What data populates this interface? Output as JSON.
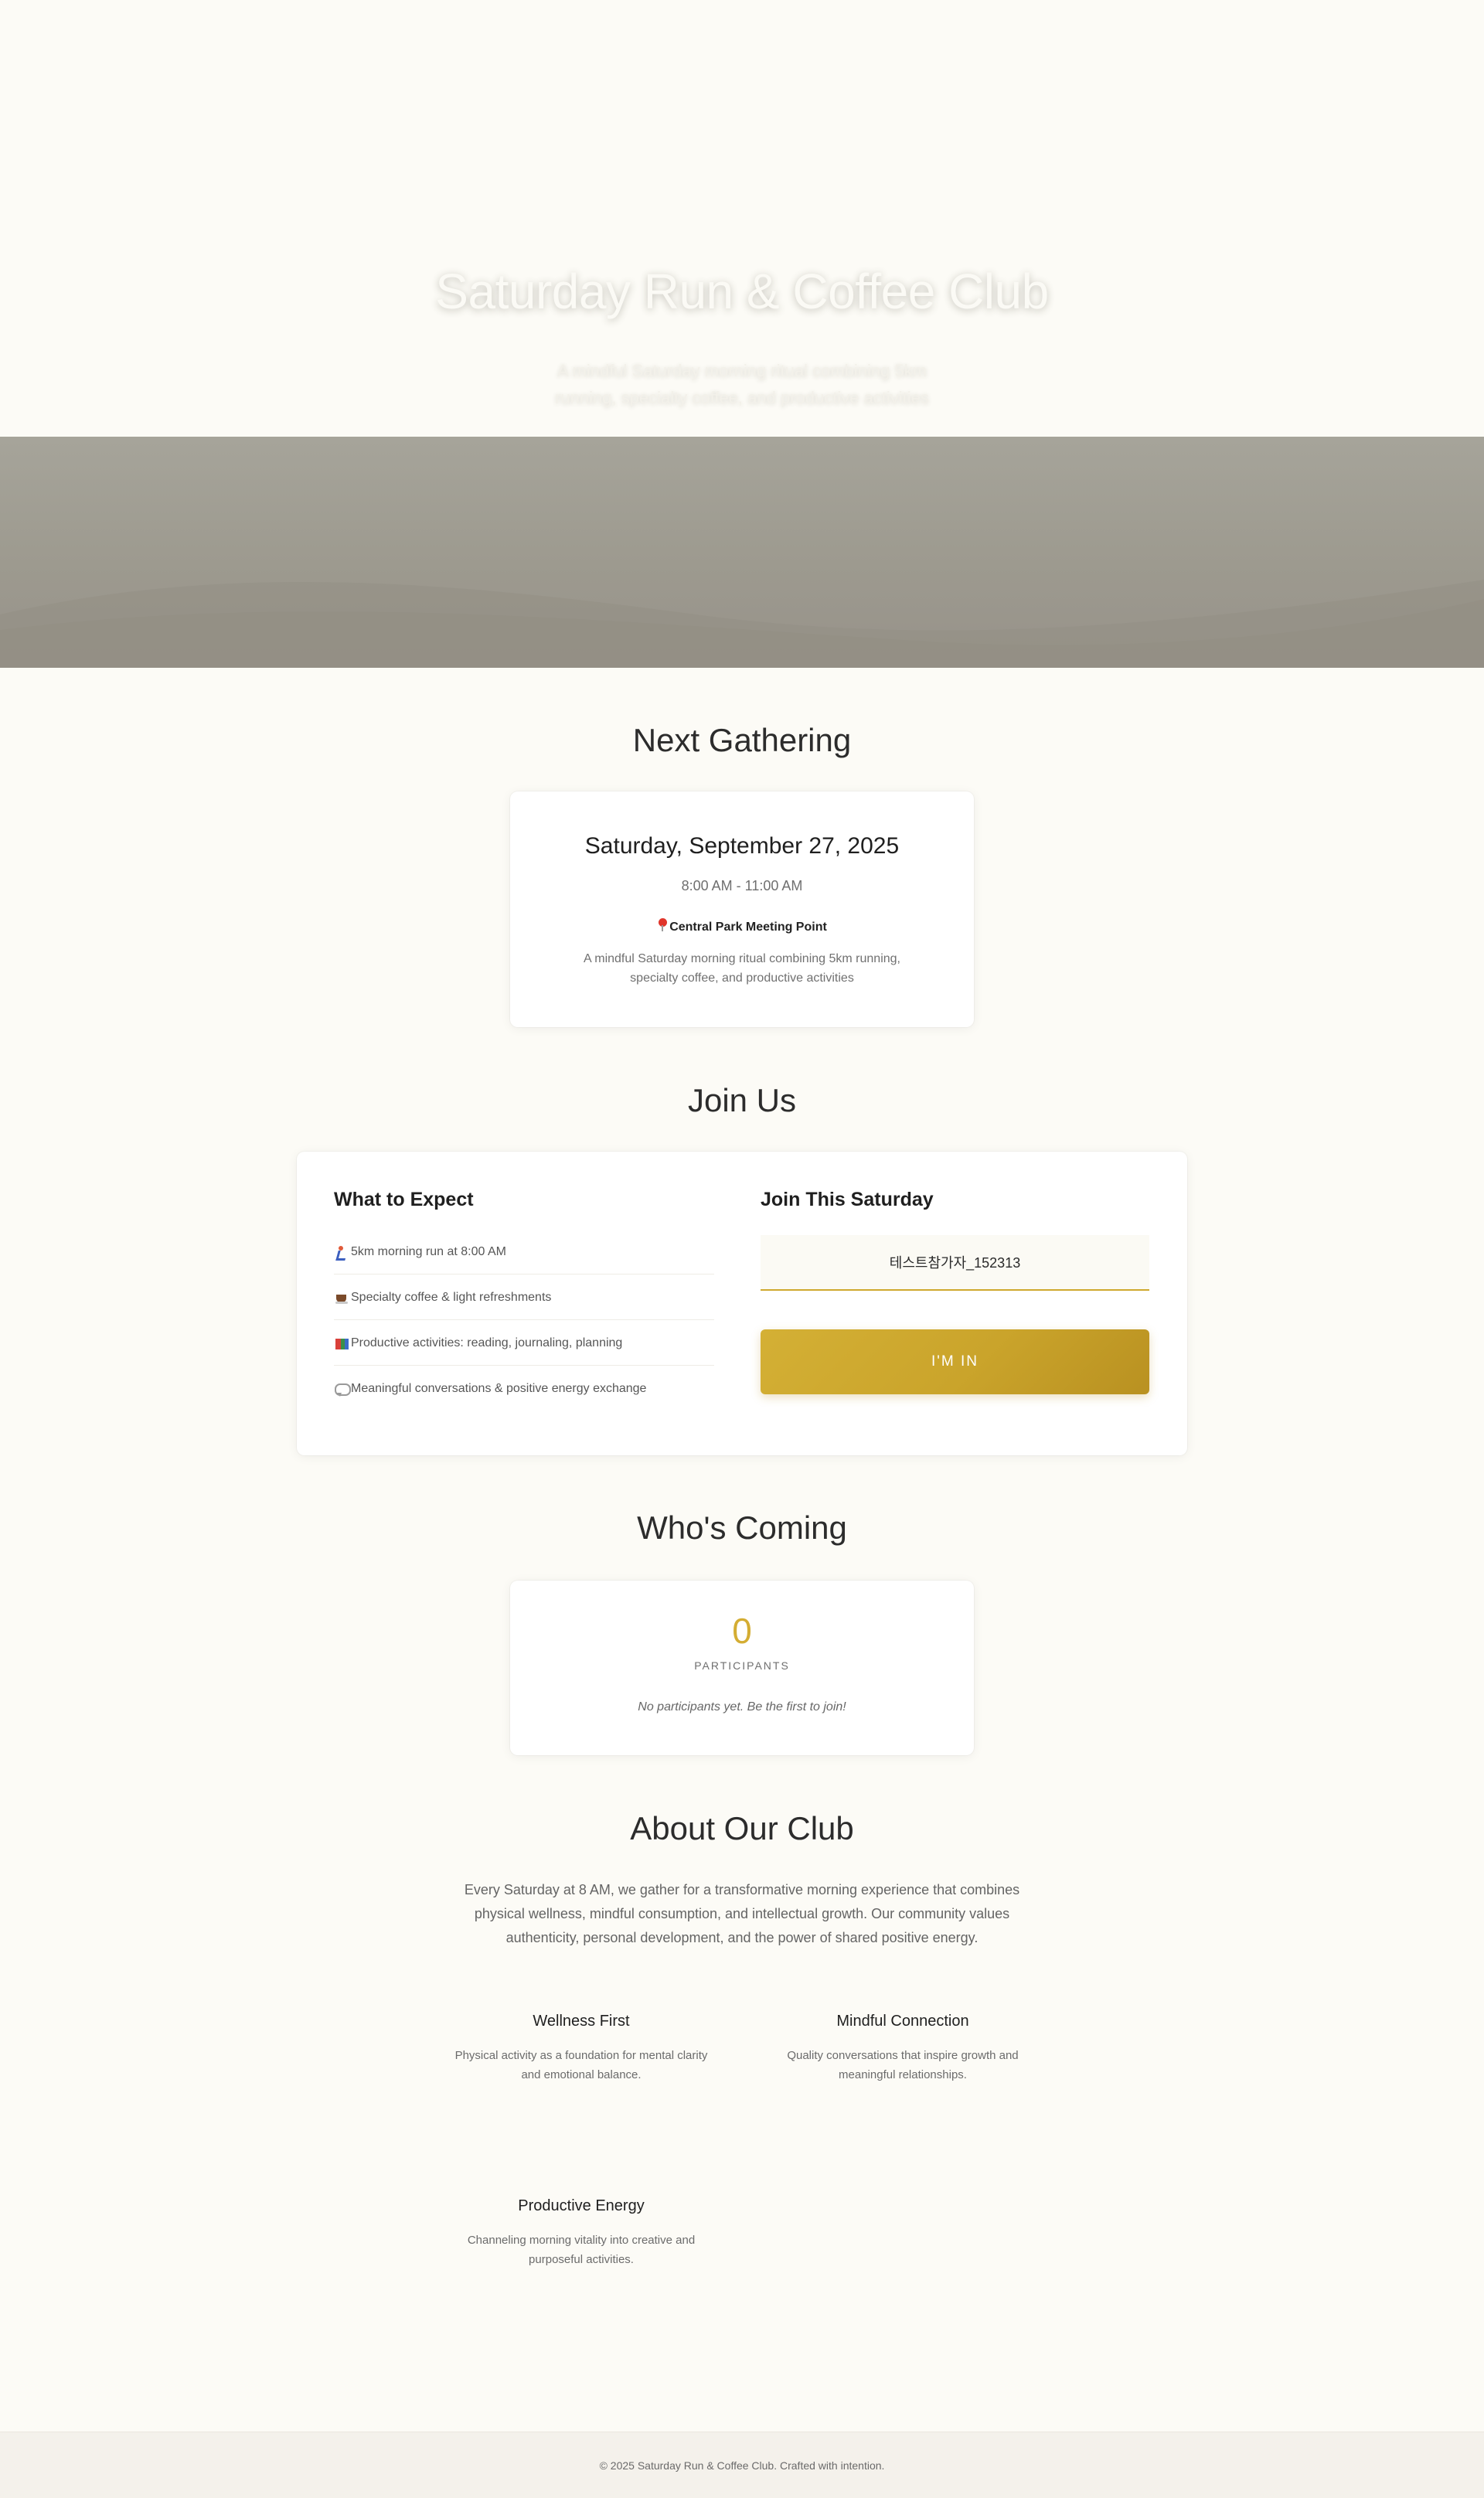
{
  "hero": {
    "title": "Saturday Run & Coffee Club",
    "subtitle": "A mindful Saturday morning ritual combining 5km running, specialty coffee, and productive activities"
  },
  "next_gathering": {
    "heading": "Next Gathering",
    "date": "Saturday, September 27, 2025",
    "time": "8:00 AM - 11:00 AM",
    "location": "Central Park Meeting Point",
    "location_icon": "pin-icon",
    "description": "A mindful Saturday morning ritual combining 5km running, specialty coffee, and productive activities"
  },
  "join_us": {
    "heading": "Join Us",
    "expect": {
      "heading": "What to Expect",
      "items": [
        {
          "icon": "runner-icon",
          "label": "5km morning run at 8:00 AM"
        },
        {
          "icon": "coffee-icon",
          "label": "Specialty coffee & light refreshments"
        },
        {
          "icon": "books-icon",
          "label": "Productive activities: reading, journaling, planning"
        },
        {
          "icon": "speech-bubble-icon",
          "label": "Meaningful conversations & positive energy exchange"
        }
      ]
    },
    "form": {
      "heading": "Join This Saturday",
      "name_value": "테스트참가자_152313",
      "button_label": "I'M IN"
    }
  },
  "whos_coming": {
    "heading": "Who's Coming",
    "count": "0",
    "count_label": "PARTICIPANTS",
    "empty_message": "No participants yet. Be the first to join!"
  },
  "about": {
    "heading": "About Our Club",
    "text": "Every Saturday at 8 AM, we gather for a transformative morning experience that combines physical wellness, mindful consumption, and intellectual growth. Our community values authenticity, personal development, and the power of shared positive energy.",
    "features": [
      {
        "title": "Wellness First",
        "description": "Physical activity as a foundation for mental clarity and emotional balance."
      },
      {
        "title": "Mindful Connection",
        "description": "Quality conversations that inspire growth and meaningful relationships."
      },
      {
        "title": "Productive Energy",
        "description": "Channeling morning vitality into creative and purposeful activities."
      }
    ]
  },
  "footer": {
    "text": "© 2025 Saturday Run & Coffee Club. Crafted with intention."
  },
  "colors": {
    "accent_gold": "#cfa82e",
    "background": "#fcfbf6",
    "hero_band": "#a09d93"
  }
}
